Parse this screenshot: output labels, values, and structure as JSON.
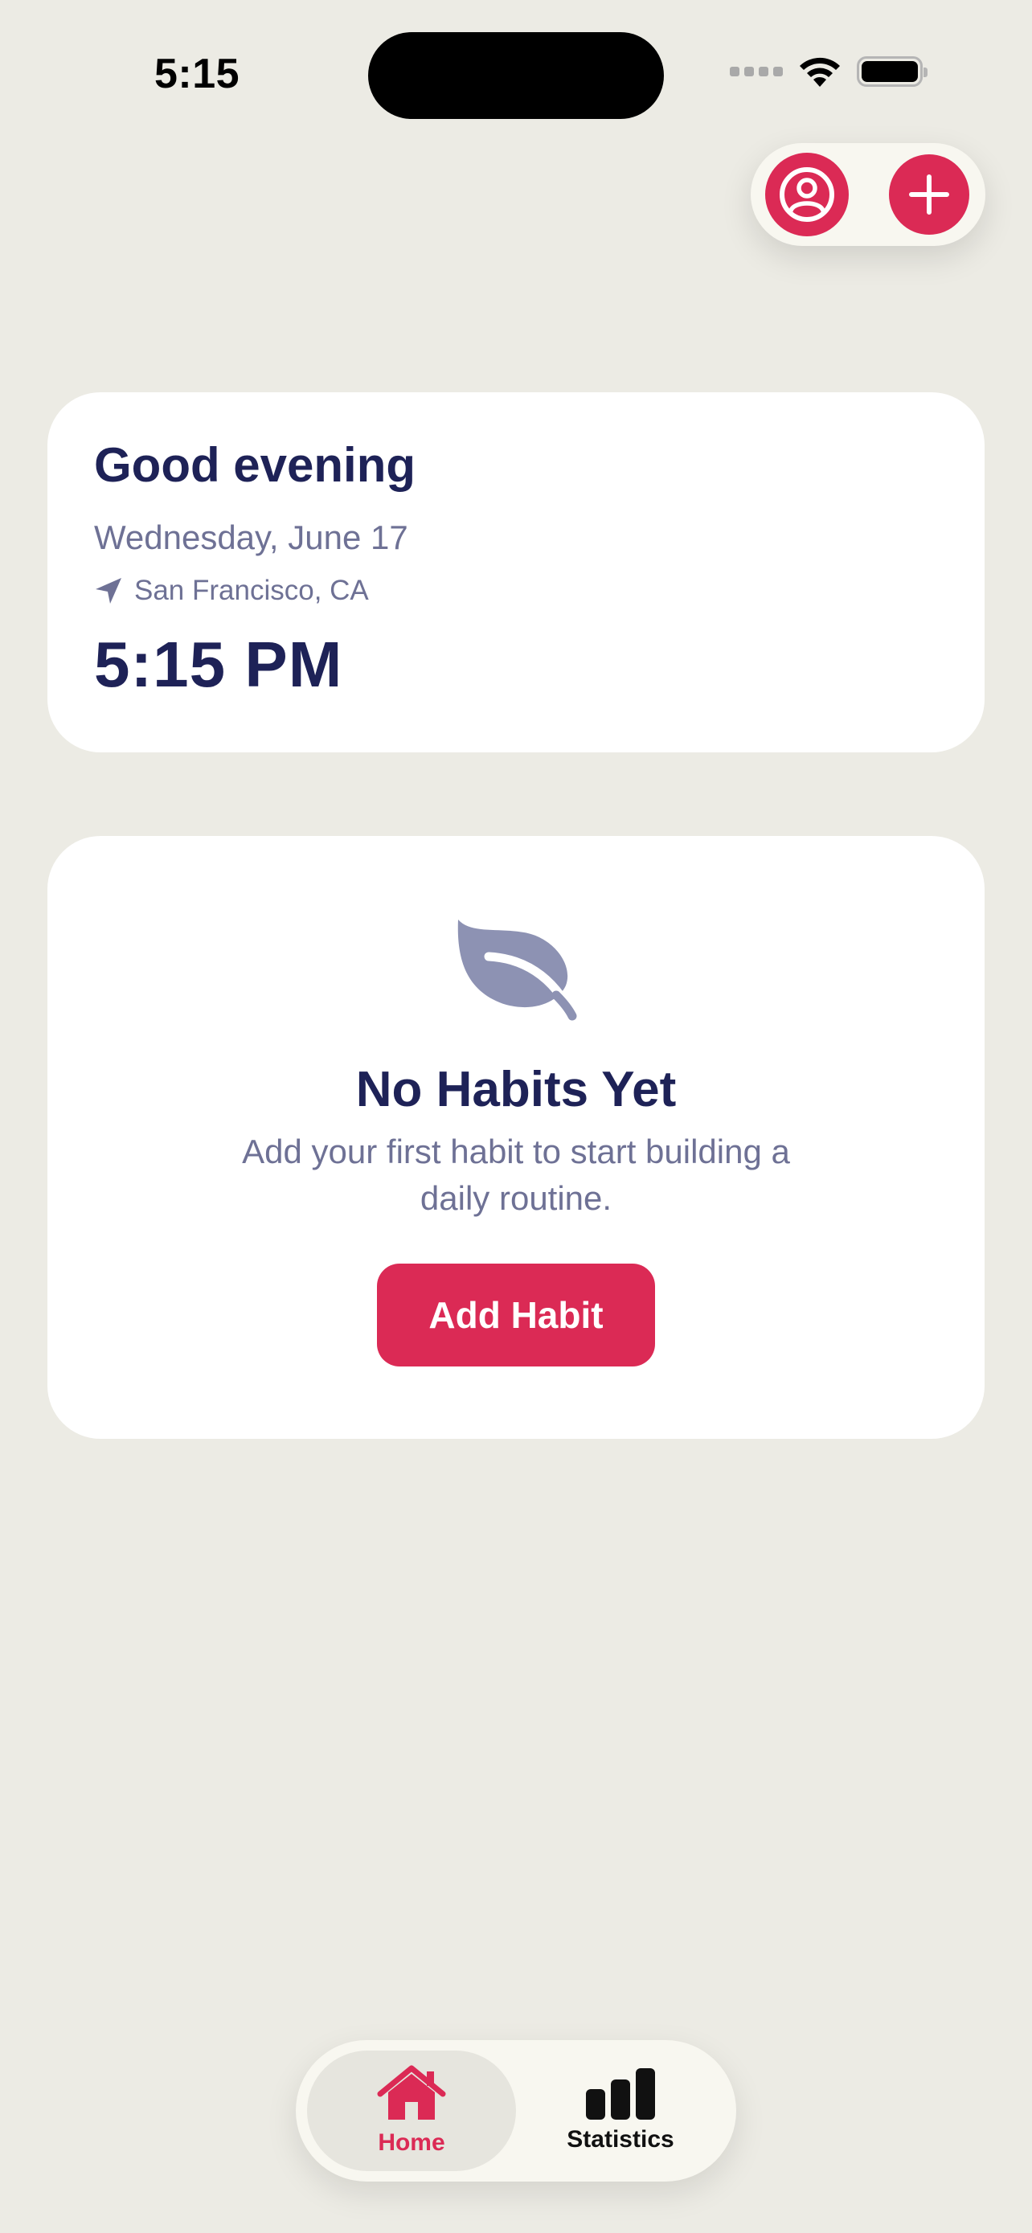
{
  "status_bar": {
    "time": "5:15"
  },
  "top_actions": [
    {
      "icon": "person-circle-icon"
    },
    {
      "icon": "plus-icon"
    }
  ],
  "greeting_card": {
    "greeting": "Good evening",
    "date": "Wednesday, June 17",
    "location": "San Francisco, CA",
    "time": "5:15 PM"
  },
  "empty_state": {
    "icon": "leaf-icon",
    "title": "No Habits Yet",
    "description": "Add your first habit to start building a daily routine.",
    "button_label": "Add Habit"
  },
  "tabbar": {
    "tabs": [
      {
        "label": "Home",
        "icon": "house-icon",
        "active": true
      },
      {
        "label": "Statistics",
        "icon": "bar-chart-icon",
        "active": false
      }
    ]
  },
  "colors": {
    "background": "#ECEBE4",
    "accent": "#DB2A55",
    "heading": "#1E2257",
    "secondary_text": "#6E7195",
    "leaf": "#8D92B3"
  }
}
